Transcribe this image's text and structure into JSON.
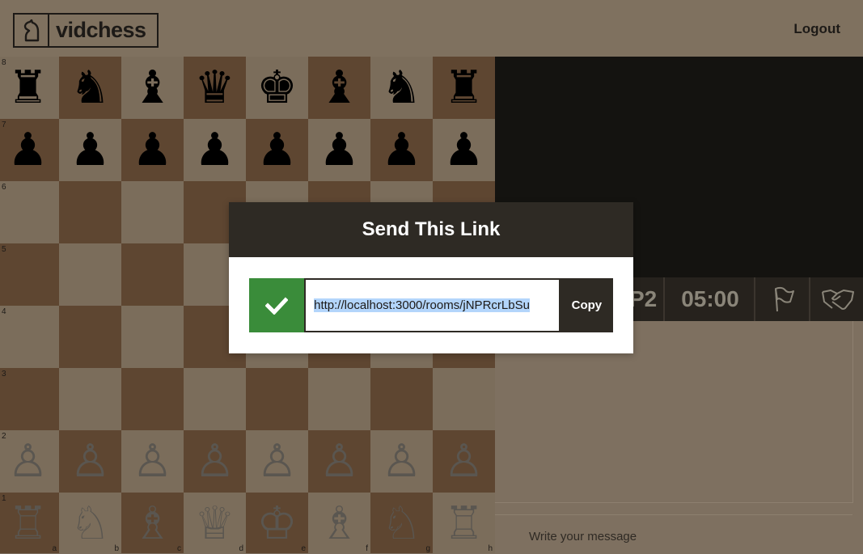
{
  "header": {
    "logo_text": "vidchess",
    "logout_label": "Logout"
  },
  "board": {
    "ranks": [
      "8",
      "7",
      "6",
      "5",
      "4",
      "3",
      "2",
      "1"
    ],
    "files": [
      "a",
      "b",
      "c",
      "d",
      "e",
      "f",
      "g",
      "h"
    ],
    "back_rank_black": [
      "♜",
      "♞",
      "♝",
      "♛",
      "♚",
      "♝",
      "♞",
      "♜"
    ],
    "pawn_black": "♟",
    "back_rank_white": [
      "♖",
      "♘",
      "♗",
      "♕",
      "♔",
      "♗",
      "♘",
      "♖"
    ],
    "pawn_white": "♙"
  },
  "game": {
    "player_label": "P2",
    "timer": "05:00",
    "resign_icon": "flag-icon",
    "draw_icon": "handshake-icon"
  },
  "chat": {
    "placeholder": "Write your message"
  },
  "modal": {
    "title": "Send This Link",
    "url": "http://localhost:3000/rooms/jNPRcrLbSu",
    "copy_label": "Copy",
    "status_icon": "check-icon"
  },
  "colors": {
    "light_square": "#7b6d5b",
    "dark_square": "#5e4631",
    "success": "#3a8c3a",
    "modal_header": "#2e2a24"
  }
}
